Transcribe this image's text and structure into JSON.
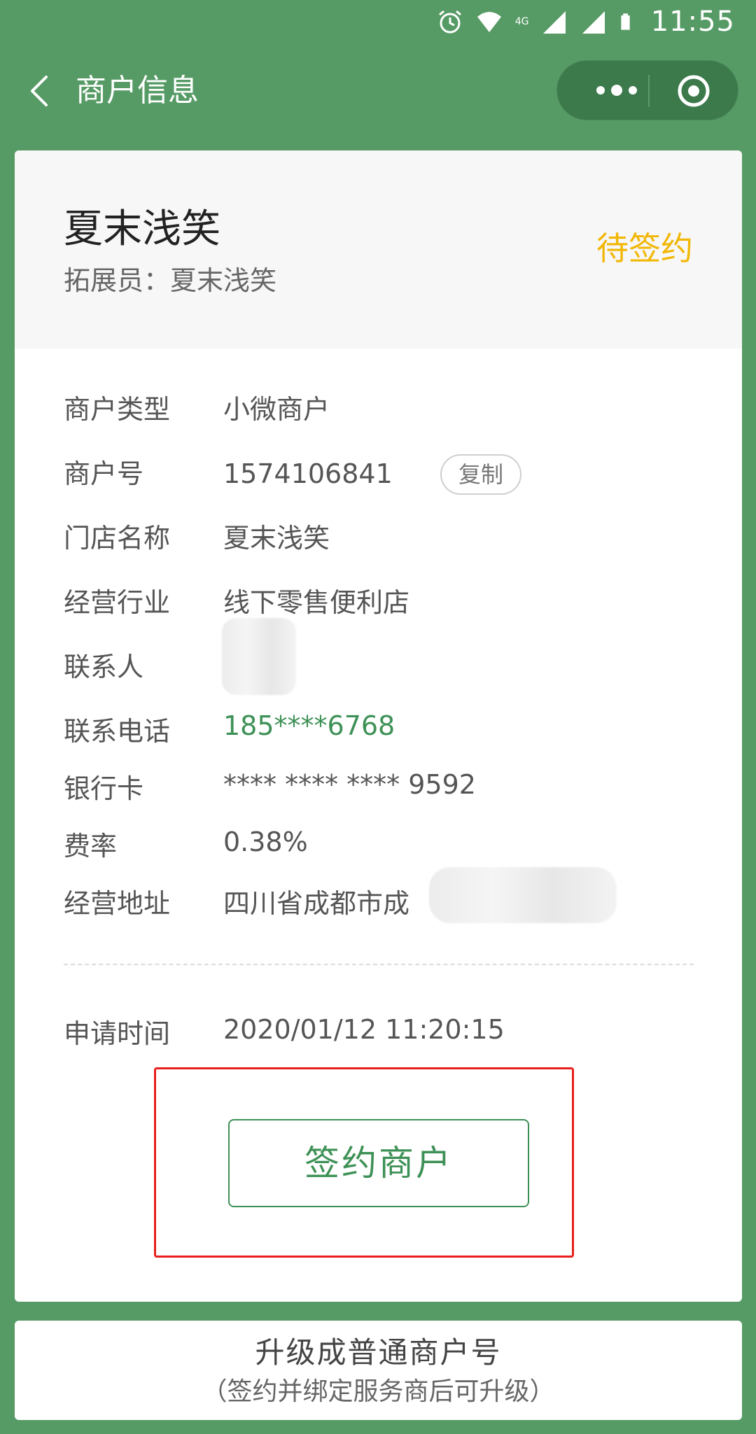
{
  "status_bar": {
    "time": "11:55",
    "network_label": "4G"
  },
  "nav": {
    "title": "商户信息"
  },
  "merchant": {
    "name": "夏末浅笑",
    "expander": "拓展员：夏末浅笑",
    "status": "待签约"
  },
  "details": [
    {
      "label": "商户类型",
      "value": "小微商户"
    },
    {
      "label": "商户号",
      "value": "1574106841"
    },
    {
      "label": "门店名称",
      "value": "夏末浅笑"
    },
    {
      "label": "经营行业",
      "value": "线下零售便利店"
    },
    {
      "label": "联系人",
      "value": ""
    },
    {
      "label": "联系电话",
      "value": "185****6768"
    },
    {
      "label": "银行卡",
      "value": "**** **** **** 9592"
    },
    {
      "label": "费率",
      "value": "0.38%"
    },
    {
      "label": "经营地址",
      "value": "四川省成都市成"
    }
  ],
  "copy_label": "复制",
  "apply_time": {
    "label": "申请时间",
    "value": "2020/01/12 11:20:15"
  },
  "actions": {
    "sign_label": "签约商户"
  },
  "upgrade": {
    "title": "升级成普通商户号",
    "subtitle": "（签约并绑定服务商后可升级）"
  },
  "colors": {
    "background": "#569b65",
    "status_pending": "#f2b705",
    "accent_green": "#3e9156",
    "highlight_red": "#e8201c"
  }
}
